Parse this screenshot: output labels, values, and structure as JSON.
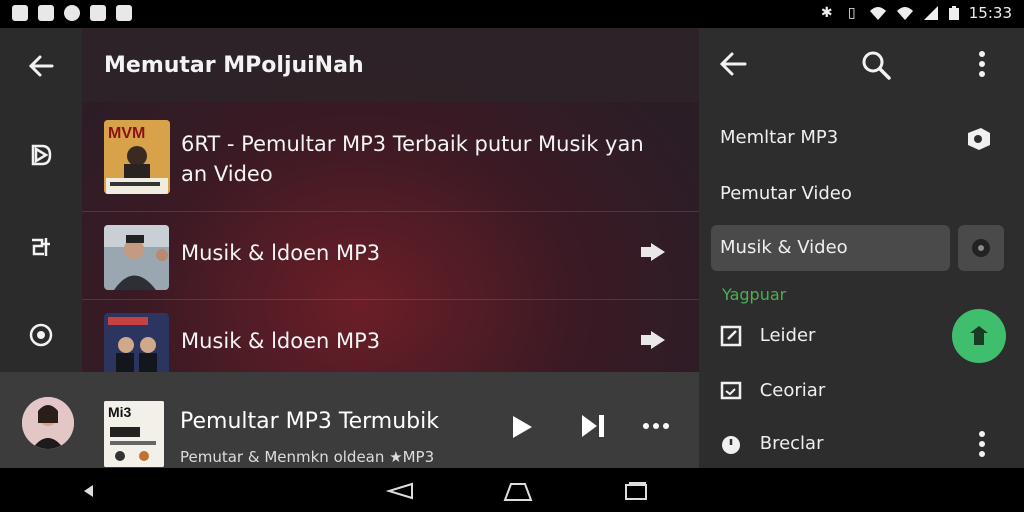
{
  "status_bar": {
    "time": "15:33"
  },
  "main": {
    "title": "Memutar MPoljuiNah",
    "rows": [
      {
        "title_line1": "6RT - Pemultar MP3 Terbaik  putur Musik yan",
        "title_line2": "an Video"
      },
      {
        "title": "Musik & ldoen MP3"
      },
      {
        "title": "Musik & ldoen MP3"
      }
    ]
  },
  "drawer": {
    "items": [
      {
        "label": "Memltar MP3"
      },
      {
        "label": "Pemutar Video"
      },
      {
        "label": "Musik & Video"
      }
    ],
    "section_label": "Yagpuar",
    "sub_items": [
      {
        "label": "Leider"
      },
      {
        "label": "Ceoriar"
      },
      {
        "label": "Breclar"
      }
    ]
  },
  "player": {
    "title": "Pemultar MP3 Termubik",
    "subtitle": "Pemutar & Menmkn oldean ★MP3"
  },
  "colors": {
    "accent_green": "#3fbf6e",
    "section_green": "#4caf50",
    "drawer_bg": "#2d2d2d",
    "player_bg": "#3c3c3c"
  },
  "icons": [
    "back-arrow-icon",
    "search-icon",
    "more-vert-icon",
    "share-icon",
    "play-icon",
    "skip-next-icon",
    "more-horiz-icon"
  ]
}
